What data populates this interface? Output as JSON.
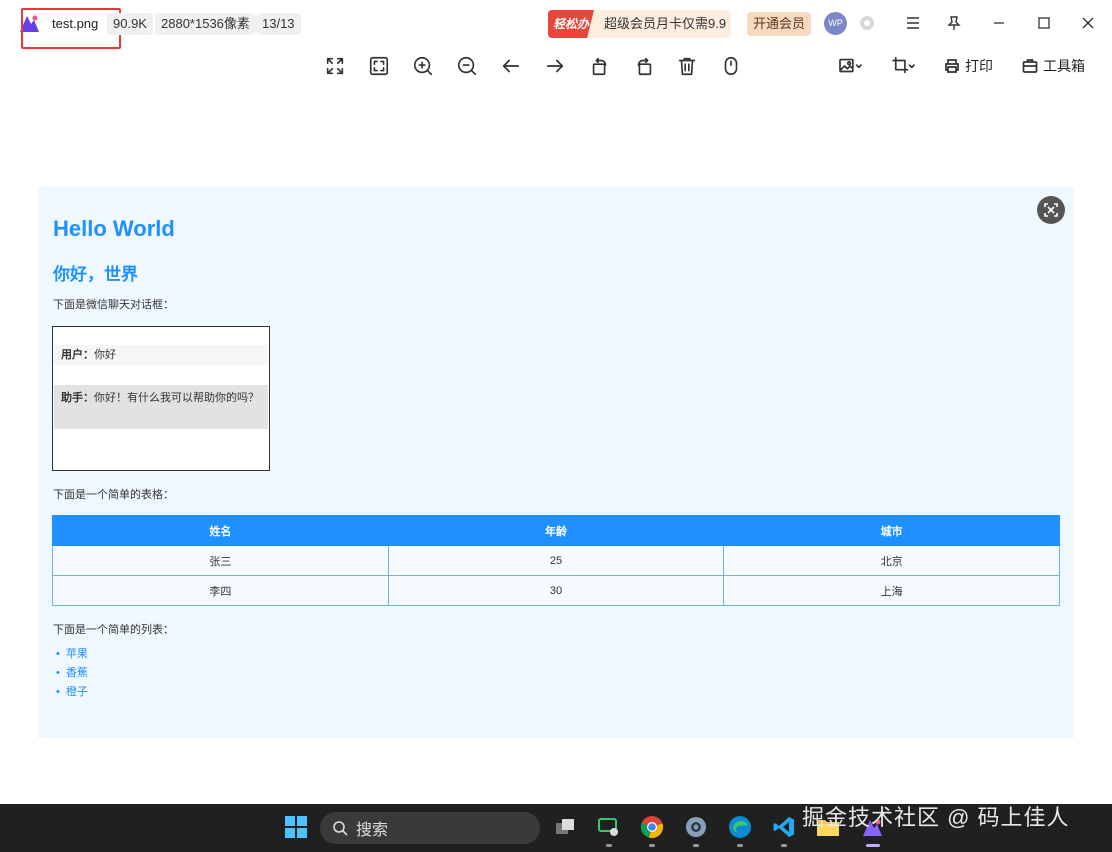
{
  "titlebar": {
    "file_name": "test.png",
    "file_size": "90.9K",
    "dimensions": "2880*1536像素",
    "counter": "13/13",
    "promo_badge": "轻松办公",
    "promo_text": "超级会员月卡仅需9.9",
    "vip_button": "开通会员",
    "avatar_text": "WP"
  },
  "toolbar": {
    "print_label": "打印",
    "toolbox_label": "工具箱"
  },
  "doc": {
    "title_en": "Hello World",
    "title_cn": "你好，世界",
    "chat_intro": "下面是微信聊天对话框：",
    "chat": {
      "user_label": "用户：",
      "user_text": "你好",
      "assistant_label": "助手：",
      "assistant_text": "你好！有什么我可以帮助你的吗？"
    },
    "table_intro": "下面是一个简单的表格：",
    "table": {
      "headers": [
        "姓名",
        "年龄",
        "城市"
      ],
      "rows": [
        [
          "张三",
          "25",
          "北京"
        ],
        [
          "李四",
          "30",
          "上海"
        ]
      ]
    },
    "list_intro": "下面是一个简单的列表：",
    "list": [
      "苹果",
      "香蕉",
      "橙子"
    ]
  },
  "taskbar": {
    "search_placeholder": "搜索"
  },
  "watermark": "掘金技术社区 @ 码上佳人",
  "colors": {
    "accent": "#1e90ff",
    "canvas_bg": "#f0f8ff",
    "promo_red": "#e8463a",
    "highlight_red": "#e53935"
  }
}
